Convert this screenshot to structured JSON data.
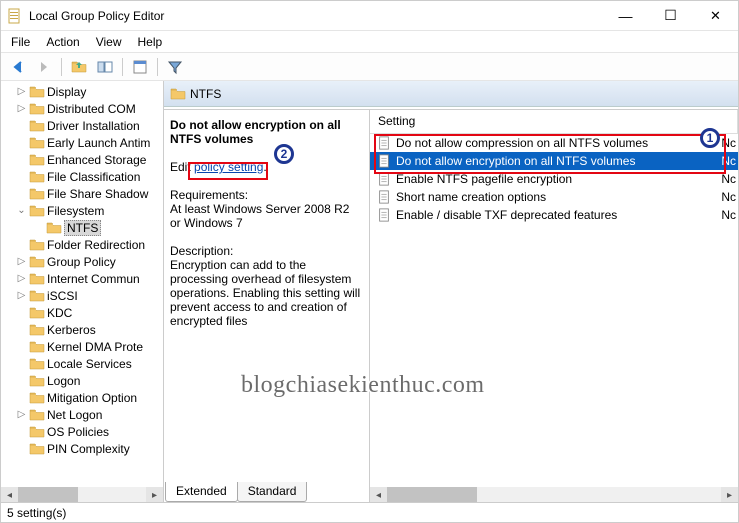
{
  "window": {
    "title": "Local Group Policy Editor"
  },
  "menu": {
    "items": [
      "File",
      "Action",
      "View",
      "Help"
    ]
  },
  "toolbar": {
    "back": "back-icon",
    "forward": "forward-icon",
    "up": "up-icon",
    "refresh": "refresh-icon",
    "export": "export-icon",
    "help": "help-icon",
    "props": "props-icon",
    "filter": "filter-icon"
  },
  "tree": {
    "items": [
      {
        "label": "Display",
        "level": 2,
        "exp": "▷"
      },
      {
        "label": "Distributed COM",
        "level": 2,
        "exp": "▷"
      },
      {
        "label": "Driver Installation",
        "level": 2,
        "exp": ""
      },
      {
        "label": "Early Launch Antim",
        "level": 2,
        "exp": ""
      },
      {
        "label": "Enhanced Storage",
        "level": 2,
        "exp": ""
      },
      {
        "label": "File Classification",
        "level": 2,
        "exp": ""
      },
      {
        "label": "File Share Shadow",
        "level": 2,
        "exp": ""
      },
      {
        "label": "Filesystem",
        "level": 2,
        "exp": "⌄",
        "expanded": true
      },
      {
        "label": "NTFS",
        "level": 3,
        "exp": "",
        "selected": true
      },
      {
        "label": "Folder Redirection",
        "level": 2,
        "exp": ""
      },
      {
        "label": "Group Policy",
        "level": 2,
        "exp": "▷"
      },
      {
        "label": "Internet Commun",
        "level": 2,
        "exp": "▷"
      },
      {
        "label": "iSCSI",
        "level": 2,
        "exp": "▷"
      },
      {
        "label": "KDC",
        "level": 2,
        "exp": ""
      },
      {
        "label": "Kerberos",
        "level": 2,
        "exp": ""
      },
      {
        "label": "Kernel DMA Prote",
        "level": 2,
        "exp": ""
      },
      {
        "label": "Locale Services",
        "level": 2,
        "exp": ""
      },
      {
        "label": "Logon",
        "level": 2,
        "exp": ""
      },
      {
        "label": "Mitigation Option",
        "level": 2,
        "exp": ""
      },
      {
        "label": "Net Logon",
        "level": 2,
        "exp": "▷"
      },
      {
        "label": "OS Policies",
        "level": 2,
        "exp": ""
      },
      {
        "label": "PIN Complexity",
        "level": 2,
        "exp": ""
      }
    ]
  },
  "content": {
    "header": "NTFS",
    "desc": {
      "title": "Do not allow encryption on all NTFS volumes",
      "edit_prefix": "Edit ",
      "edit_link": "policy setting",
      "edit_suffix": ".",
      "req_head": "Requirements:",
      "req_text": "At least Windows Server 2008 R2 or Windows 7",
      "desc_head": "Description:",
      "desc_text": "Encryption can add to the processing overhead of filesystem operations. Enabling this setting will prevent access to and creation of encrypted files"
    },
    "list": {
      "col_setting": "Setting",
      "col_state_partial": "Nc",
      "items": [
        {
          "label": "Do not allow compression on all NTFS volumes",
          "selected": false
        },
        {
          "label": "Do not allow encryption on all NTFS volumes",
          "selected": true
        },
        {
          "label": "Enable NTFS pagefile encryption",
          "selected": false
        },
        {
          "label": "Short name creation options",
          "selected": false
        },
        {
          "label": "Enable / disable TXF deprecated features",
          "selected": false
        }
      ]
    }
  },
  "tabs": {
    "extended": "Extended",
    "standard": "Standard"
  },
  "statusbar": {
    "text": "5 setting(s)"
  },
  "watermark": "blogchiasekienthuc.com",
  "markers": {
    "m1": "1",
    "m2": "2"
  }
}
